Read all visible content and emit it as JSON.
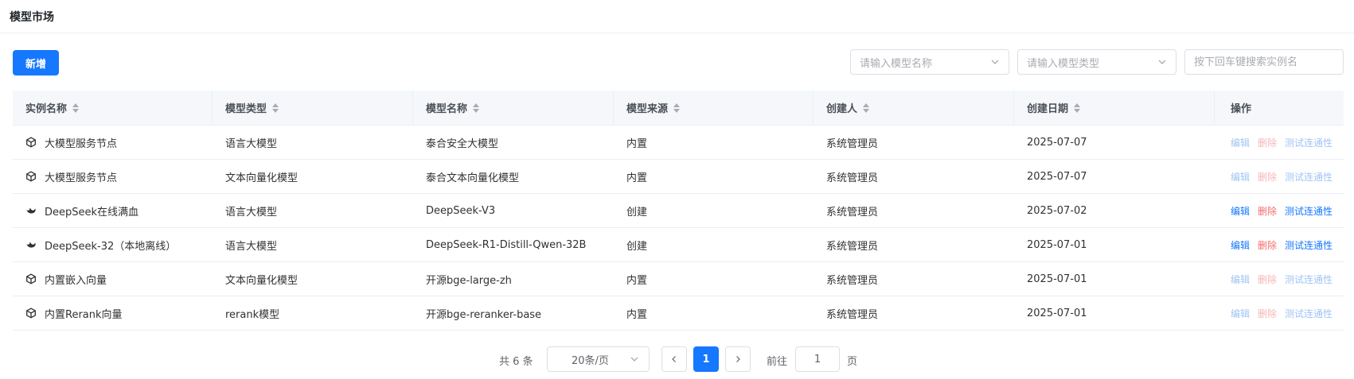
{
  "header": {
    "title": "模型市场"
  },
  "toolbar": {
    "add_label": "新增",
    "model_name_placeholder": "请输入模型名称",
    "model_type_placeholder": "请输入模型类型",
    "search_placeholder": "按下回车键搜索实例名"
  },
  "table": {
    "columns": [
      "实例名称",
      "模型类型",
      "模型名称",
      "模型来源",
      "创建人",
      "创建日期",
      "操作"
    ],
    "actions": {
      "edit": "编辑",
      "delete": "删除",
      "test": "测试连通性"
    },
    "rows": [
      {
        "icon": "cube-icon",
        "instance": "大模型服务节点",
        "type": "语言大模型",
        "model": "泰合安全大模型",
        "source": "内置",
        "creator": "系统管理员",
        "date": "2025-07-07",
        "actions_enabled": false
      },
      {
        "icon": "cube-icon",
        "instance": "大模型服务节点",
        "type": "文本向量化模型",
        "model": "泰合文本向量化模型",
        "source": "内置",
        "creator": "系统管理员",
        "date": "2025-07-07",
        "actions_enabled": false
      },
      {
        "icon": "deepseek-whale-icon",
        "instance": "DeepSeek在线满血",
        "type": "语言大模型",
        "model": "DeepSeek-V3",
        "source": "创建",
        "creator": "系统管理员",
        "date": "2025-07-02",
        "actions_enabled": true
      },
      {
        "icon": "deepseek-whale-icon",
        "instance": "DeepSeek-32（本地离线）",
        "type": "语言大模型",
        "model": "DeepSeek-R1-Distill-Qwen-32B",
        "source": "创建",
        "creator": "系统管理员",
        "date": "2025-07-01",
        "actions_enabled": true
      },
      {
        "icon": "cube-icon",
        "instance": "内置嵌入向量",
        "type": "文本向量化模型",
        "model": "开源bge-large-zh",
        "source": "内置",
        "creator": "系统管理员",
        "date": "2025-07-01",
        "actions_enabled": false
      },
      {
        "icon": "cube-icon",
        "instance": "内置Rerank向量",
        "type": "rerank模型",
        "model": "开源bge-reranker-base",
        "source": "内置",
        "creator": "系统管理员",
        "date": "2025-07-01",
        "actions_enabled": false
      }
    ]
  },
  "pagination": {
    "total_label": "共 6 条",
    "page_size": "20条/页",
    "current_page": "1",
    "goto_label": "前往",
    "goto_value": "1",
    "page_unit": "页"
  },
  "colors": {
    "primary": "#1677ff",
    "danger": "#f56c6c",
    "border": "#dcdfe6",
    "header_bg": "#f5f7fa"
  }
}
